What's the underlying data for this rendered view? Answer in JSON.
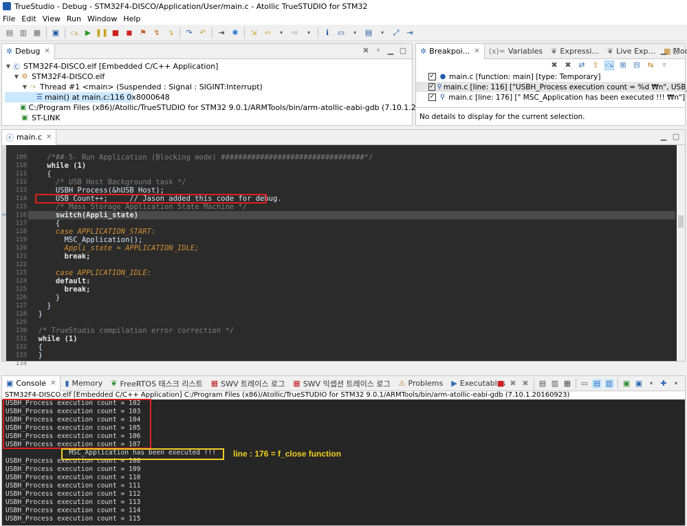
{
  "window": {
    "title": "TrueStudio - Debug - STM32F4-DISCO/Application/User/main.c - Atollic TrueSTUDIO for STM32"
  },
  "menu": [
    "File",
    "Edit",
    "View",
    "Run",
    "Window",
    "Help"
  ],
  "debug_panel": {
    "tab": "Debug",
    "tree": [
      {
        "text": "STM32F4-DISCO.elf [Embedded C/C++ Application]",
        "indent": 0,
        "icon": "c-app-icon"
      },
      {
        "text": "STM32F4-DISCO.elf",
        "indent": 1,
        "icon": "process-icon"
      },
      {
        "text": "Thread #1 <main> (Suspended : Signal : SIGINT:Interrupt)",
        "indent": 2,
        "icon": "thread-icon"
      },
      {
        "text": "main() at main.c:116 0x8000648",
        "indent": 3,
        "icon": "stack-frame-icon"
      },
      {
        "text": "C:/Program Files (x86)/Atollic/TrueSTUDIO for STM32 9.0.1/ARMTools/bin/arm-atollic-eabi-gdb (7.10.1.20160923)",
        "indent": 1,
        "icon": "gdb-icon"
      },
      {
        "text": "ST-LINK",
        "indent": 1,
        "icon": "stlink-icon"
      }
    ]
  },
  "breakpoints_panel": {
    "tabs": [
      "Breakpoi...",
      "Variables",
      "Expressi...",
      "Live Exp...",
      "Modules"
    ],
    "items": [
      "main.c [function: main] [type: Temporary]",
      "main.c [line: 116] [\"USBH_Process execution count = %d ₩n\", USB_Count]",
      "main.c [line: 176] [\"                MSC_Application has been executed !!! ₩n\"]"
    ],
    "details": "No details to display for the current selection."
  },
  "editor": {
    "tab": "main.c",
    "line_numbers": [
      "109",
      "110",
      "111",
      "112",
      "113",
      "114",
      "115",
      "116",
      "117",
      "118",
      "119",
      "120",
      "121",
      "122",
      "123",
      "124",
      "125",
      "126",
      "127",
      "128",
      "129",
      "130",
      "131",
      "132",
      "133",
      "134"
    ],
    "lines": [
      "    /*##-5- Run Application (Blocking mode) #################################*/",
      "    while (1)",
      "    {",
      "      /* USB Host Background task */",
      "      USBH_Process(&hUSB_Host);",
      "      USB_Count++;     // Jason added this code for debug.",
      "      /* Mass Storage Application State Machine */",
      "      switch(Appli_state)",
      "      {",
      "      case APPLICATION_START:",
      "        MSC_Application();",
      "        Appli_state = APPLICATION_IDLE;",
      "        break;",
      "",
      "      case APPLICATION_IDLE:",
      "      default:",
      "        break;",
      "      }",
      "    }",
      "  }",
      "",
      "  /* TrueStudio compilation error correction */",
      "  while (1)",
      "  {",
      "  }",
      ""
    ]
  },
  "console_panel": {
    "tabs": [
      "Console",
      "Memory",
      "FreeRTOS 태스크 리스트",
      "SWV 트레이스 로그",
      "SWV 익셉션 트레이스 로그",
      "Problems",
      "Executables"
    ],
    "path": "STM32F4-DISCO.elf [Embedded C/C++ Application] C:/Program Files (x86)/Atollic/TrueSTUDIO for STM32 9.0.1/ARMTools/bin/arm-atollic-eabi-gdb (7.10.1.20160923)",
    "lines": [
      "USBH_Process execution count = 102",
      "USBH_Process execution count = 103",
      "USBH_Process execution count = 104",
      "USBH_Process execution count = 105",
      "USBH_Process execution count = 106",
      "USBH_Process execution count = 107",
      "                MSC_Application has been executed !!!",
      "USBH_Process execution count = 108",
      "USBH_Process execution count = 109",
      "USBH_Process execution count = 110",
      "USBH_Process execution count = 111",
      "USBH_Process execution count = 112",
      "USBH_Process execution count = 113",
      "USBH_Process execution count = 114",
      "USBH_Process execution count = 115"
    ]
  },
  "annotation": {
    "text": "line : 176 = f_close function"
  },
  "colors": {
    "annotation_red": "#e02020",
    "annotation_yellow": "#f0d020",
    "editor_bg": "#2b2b2b",
    "console_bg": "#262626"
  }
}
